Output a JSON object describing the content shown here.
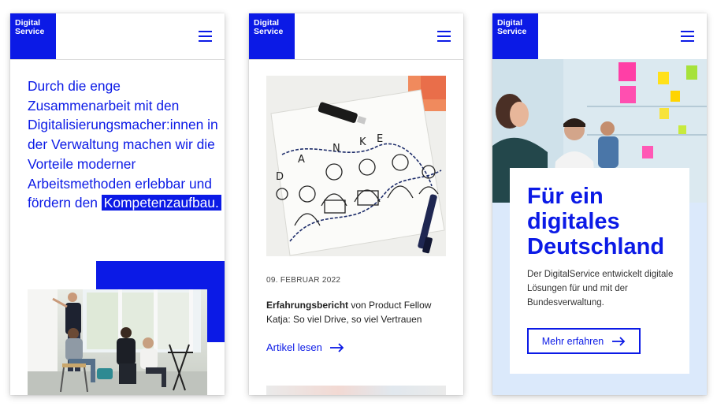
{
  "brand": {
    "line1": "Digital",
    "line2": "Service",
    "color": "#0b1ae6"
  },
  "icons": {
    "menu": "hamburger-menu-icon",
    "arrow": "arrow-right-icon"
  },
  "panel1": {
    "text": "Durch die enge Zusammenarbeit mit den Digitalisierungsmacher:innen in der Verwaltung machen wir die Vorteile moderner Arbeitsmethoden erlebbar und fördern den",
    "highlight": "Kompetenzaufbau."
  },
  "panel2": {
    "sketch_letters": [
      "D",
      "A",
      "N",
      "K",
      "E"
    ],
    "date": "09. FEBRUAR 2022",
    "teaser_bold": "Erfahrungsbericht",
    "teaser_rest": "von Product Fellow Katja: So viel Drive, so viel Vertrauen",
    "link": "Artikel lesen"
  },
  "panel3": {
    "title_line1": "Für ein",
    "title_line2": "digitales",
    "title_line3": "Deutschland",
    "description": "Der DigitalService entwickelt digitale Lösungen für und mit der Bundesverwaltung.",
    "button": "Mehr erfahren",
    "bg_color": "#dbe9fb"
  }
}
